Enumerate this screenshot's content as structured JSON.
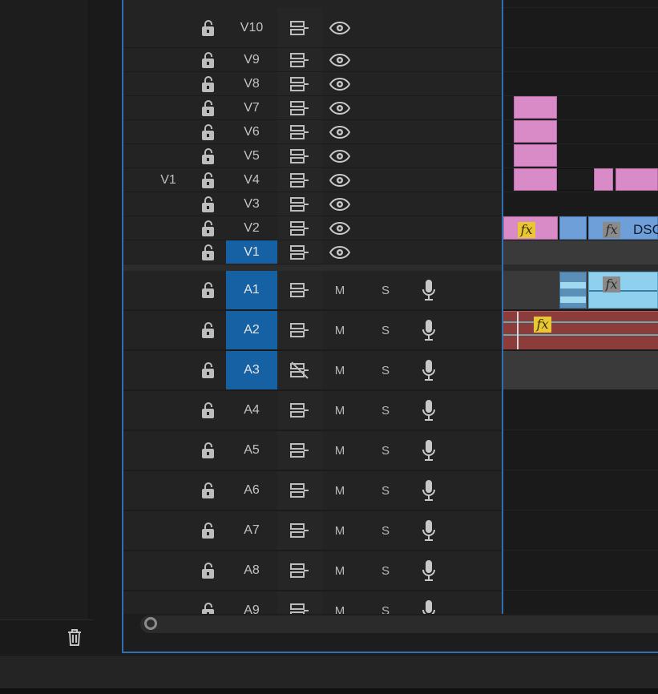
{
  "source_patch": {
    "video": "V1"
  },
  "video_tracks": [
    {
      "label": "V10",
      "active": false
    },
    {
      "label": "V9",
      "active": false
    },
    {
      "label": "V8",
      "active": false
    },
    {
      "label": "V7",
      "active": false
    },
    {
      "label": "V6",
      "active": false
    },
    {
      "label": "V5",
      "active": false
    },
    {
      "label": "V4",
      "active": false
    },
    {
      "label": "V3",
      "active": false
    },
    {
      "label": "V2",
      "active": false
    },
    {
      "label": "V1",
      "active": true
    }
  ],
  "audio_tracks": [
    {
      "label": "A1",
      "active": true,
      "sync_lock_off": false
    },
    {
      "label": "A2",
      "active": true,
      "sync_lock_off": false
    },
    {
      "label": "A3",
      "active": true,
      "sync_lock_off": true
    },
    {
      "label": "A4",
      "active": false,
      "sync_lock_off": false
    },
    {
      "label": "A5",
      "active": false,
      "sync_lock_off": false
    },
    {
      "label": "A6",
      "active": false,
      "sync_lock_off": false
    },
    {
      "label": "A7",
      "active": false,
      "sync_lock_off": false
    },
    {
      "label": "A8",
      "active": false,
      "sync_lock_off": false
    },
    {
      "label": "A9",
      "active": false,
      "sync_lock_off": false
    }
  ],
  "audio_buttons": {
    "mute": "M",
    "solo": "S"
  },
  "clips": {
    "v2_clip_name": "DSC",
    "fx_label": "fx"
  },
  "colors": {
    "selected_track": "#1561a3",
    "panel_border": "#2f6fb3",
    "video_clip_pink": "#d98bc8",
    "video_clip_blue": "#6f9fd8",
    "audio_clip_blue": "#8ed0ee",
    "audio_clip_red": "#8d3c3c",
    "fx_badge": "#e8c634"
  },
  "icons": {
    "lock": "lock-open-icon",
    "sync": "sync-lock-icon",
    "eye": "eye-icon",
    "mic": "microphone-icon",
    "trash": "trash-icon"
  }
}
